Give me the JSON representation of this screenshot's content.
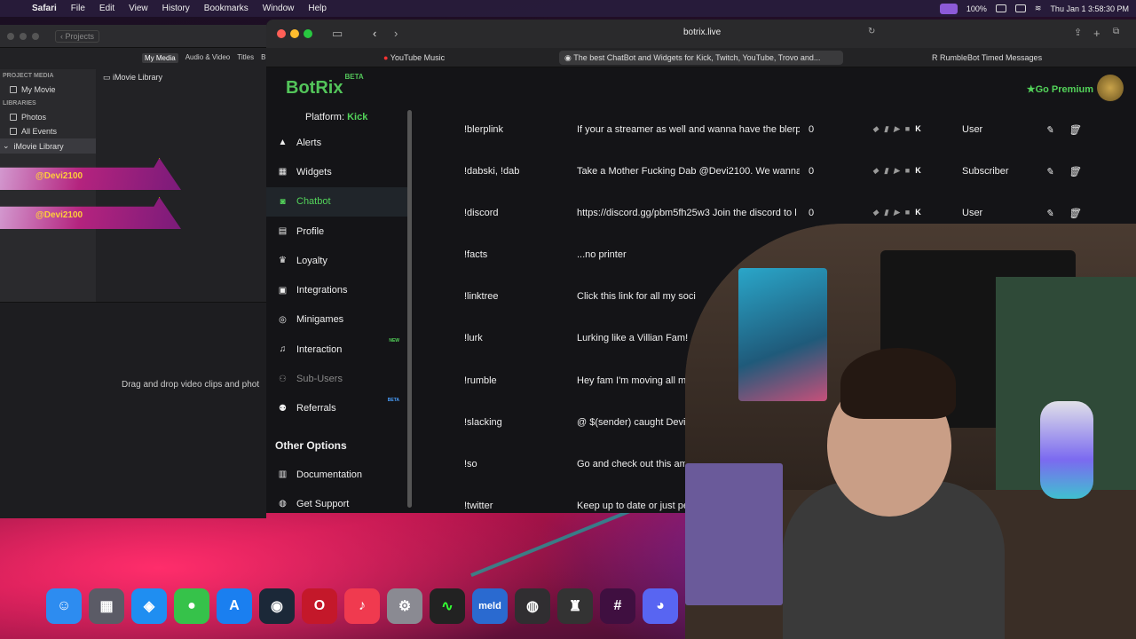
{
  "menubar": {
    "app": "Safari",
    "items": [
      "File",
      "Edit",
      "View",
      "History",
      "Bookmarks",
      "Window",
      "Help"
    ],
    "battery": "100%",
    "datetime": "Thu Jan 1  3:58:30 PM"
  },
  "imovie": {
    "projects_label": "Projects",
    "tabs": [
      "My Media",
      "Audio & Video",
      "Titles",
      "B"
    ],
    "project_media_header": "PROJECT MEDIA",
    "project_item": "My Movie",
    "libraries_header": "LIBRARIES",
    "library_items": [
      "Photos",
      "All Events",
      "iMovie Library"
    ],
    "library_title": "iMovie Library",
    "clip_labels": [
      "@Devi2100",
      "@Devi2100"
    ],
    "drop_text": "Drag and drop video clips and phot"
  },
  "browser": {
    "url": "botrix.live",
    "tabs": [
      "YouTube Music",
      "The best ChatBot and Widgets for Kick, Twitch, YouTube, Trovo and...",
      "RumbleBot Timed Messages"
    ]
  },
  "site": {
    "logo": "BotRix",
    "logo_badge": "BETA",
    "premium": "Go Premium",
    "platform_label": "Platform: ",
    "platform": "Kick",
    "nav": [
      {
        "label": "Alerts",
        "icon": "warning-icon"
      },
      {
        "label": "Widgets",
        "icon": "grid-icon"
      },
      {
        "label": "Chatbot",
        "icon": "robot-icon"
      },
      {
        "label": "Profile",
        "icon": "id-card-icon"
      },
      {
        "label": "Loyalty",
        "icon": "trophy-icon"
      },
      {
        "label": "Integrations",
        "icon": "plug-icon"
      },
      {
        "label": "Minigames",
        "icon": "gamepad-icon"
      },
      {
        "label": "Interaction",
        "icon": "music-icon",
        "badge": "NEW"
      },
      {
        "label": "Sub-Users",
        "icon": "users-icon"
      },
      {
        "label": "Referrals",
        "icon": "referral-icon",
        "badge": "BETA"
      }
    ],
    "other_options": "Other Options",
    "other_nav": [
      {
        "label": "Documentation",
        "icon": "book-icon"
      },
      {
        "label": "Get Support",
        "icon": "support-icon"
      }
    ],
    "commands": [
      {
        "cmd": "!blerplink",
        "resp": "If your a streamer as well and wanna have the blerp c",
        "cd": "0",
        "role": "User"
      },
      {
        "cmd": "!dabski, !dab",
        "resp": "Take a Mother Fucking Dab @Devi2100. We wanna s",
        "cd": "0",
        "role": "Subscriber"
      },
      {
        "cmd": "!discord",
        "resp": "https://discord.gg/pbm5fh25w3 Join the discord to l",
        "cd": "0",
        "role": "User"
      },
      {
        "cmd": "!facts",
        "resp": "...no printer"
      },
      {
        "cmd": "!linktree",
        "resp": "Click this link for all my soci"
      },
      {
        "cmd": "!lurk",
        "resp": "Lurking like a Villian Fam!"
      },
      {
        "cmd": "!rumble",
        "resp": "Hey fam I'm moving all m"
      },
      {
        "cmd": "!slacking",
        "resp": "@ $(sender) caught Devi"
      },
      {
        "cmd": "!so",
        "resp": "Go and check out this am"
      },
      {
        "cmd": "!twitter",
        "resp": "Keep up to date or just pe"
      }
    ]
  },
  "dock": [
    "finder",
    "launchpad",
    "safari",
    "messages",
    "app-store",
    "steam",
    "opera",
    "music",
    "settings",
    "activity-monitor",
    "meld",
    "obs",
    "voice",
    "slack",
    "discord"
  ]
}
